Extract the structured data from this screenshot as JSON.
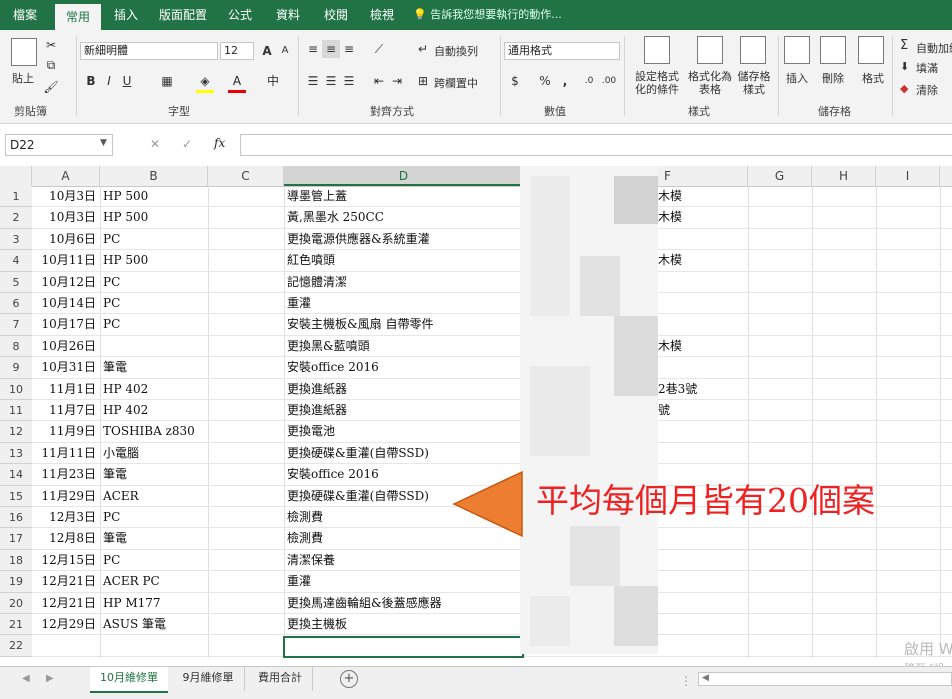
{
  "menu": {
    "items": [
      "檔案",
      "常用",
      "插入",
      "版面配置",
      "公式",
      "資料",
      "校閱",
      "檢視"
    ],
    "active": "常用",
    "tell_me": "告訴我您想要執行的動作..."
  },
  "ribbon": {
    "clipboard": {
      "paste_label": "貼上",
      "group": "剪貼簿"
    },
    "font": {
      "name": "新細明體",
      "size": "12",
      "bold": "B",
      "italic": "I",
      "underline": "U",
      "grow": "A",
      "shrink": "A",
      "group": "字型"
    },
    "alignment": {
      "wrap": "自動換列",
      "merge": "跨欄置中",
      "group": "對齊方式"
    },
    "number": {
      "format": "通用格式",
      "currency": "$",
      "percent": "%",
      "comma": ",",
      "group": "數值"
    },
    "styles": {
      "conditional": "設定格式化的條件",
      "table": "格式化為表格",
      "cell": "儲存格樣式",
      "group": "樣式"
    },
    "cells": {
      "insert": "插入",
      "delete": "刪除",
      "format": "格式",
      "group": "儲存格"
    },
    "editing": {
      "autosum": "自動加總",
      "fill": "填滿",
      "clear": "清除"
    }
  },
  "namebox": "D22",
  "fx_label": "fx",
  "columns": [
    "A",
    "B",
    "C",
    "D",
    "E",
    "F",
    "G",
    "H",
    "I"
  ],
  "selected_column": "D",
  "rows": [
    {
      "n": "1",
      "a": "10月3日",
      "b": "HP 500",
      "d": "導墨管上蓋",
      "f": "木模"
    },
    {
      "n": "2",
      "a": "10月3日",
      "b": "HP 500",
      "d": "黃,黑墨水 250CC",
      "f": "木模"
    },
    {
      "n": "3",
      "a": "10月6日",
      "b": "PC",
      "d": "更換電源供應器&系統重灌",
      "f": ""
    },
    {
      "n": "4",
      "a": "10月11日",
      "b": "HP 500",
      "d": "紅色噴頭",
      "f": "木模"
    },
    {
      "n": "5",
      "a": "10月12日",
      "b": "PC",
      "d": "記憶體清潔",
      "f": ""
    },
    {
      "n": "6",
      "a": "10月14日",
      "b": "PC",
      "d": "重灌",
      "f": ""
    },
    {
      "n": "7",
      "a": "10月17日",
      "b": "PC",
      "d": "安裝主機板&風扇 自帶零件",
      "f": ""
    },
    {
      "n": "8",
      "a": "10月26日",
      "b": "",
      "d": "更換黑&藍噴頭",
      "f": "木模"
    },
    {
      "n": "9",
      "a": "10月31日",
      "b": "筆電",
      "d": "安裝office 2016",
      "f": ""
    },
    {
      "n": "10",
      "a": "11月1日",
      "b": "HP 402",
      "d": "更換進紙器",
      "f": "2巷3號"
    },
    {
      "n": "11",
      "a": "11月7日",
      "b": "HP 402",
      "d": "更換進紙器",
      "f": "號"
    },
    {
      "n": "12",
      "a": "11月9日",
      "b": "TOSHIBA z830",
      "d": "更換電池",
      "f": ""
    },
    {
      "n": "13",
      "a": "11月11日",
      "b": "小電腦",
      "d": "更換硬碟&重灌(自帶SSD)",
      "f": ""
    },
    {
      "n": "14",
      "a": "11月23日",
      "b": "筆電",
      "d": "安裝office 2016",
      "f": ""
    },
    {
      "n": "15",
      "a": "11月29日",
      "b": "ACER",
      "d": "更換硬碟&重灌(自帶SSD)",
      "f": ""
    },
    {
      "n": "16",
      "a": "12月3日",
      "b": "PC",
      "d": "檢測費",
      "f": ""
    },
    {
      "n": "17",
      "a": "12月8日",
      "b": "筆電",
      "d": "檢測費",
      "f": ""
    },
    {
      "n": "18",
      "a": "12月15日",
      "b": "PC",
      "d": "清潔保養",
      "f": ""
    },
    {
      "n": "19",
      "a": "12月21日",
      "b": "ACER PC",
      "d": "重灌",
      "f": ""
    },
    {
      "n": "20",
      "a": "12月21日",
      "b": "HP M177",
      "d": "更換馬達齒輪組&後蓋感應器",
      "f": ""
    },
    {
      "n": "21",
      "a": "12月29日",
      "b": "ASUS 筆電",
      "d": "更換主機板",
      "f": ""
    },
    {
      "n": "22",
      "a": "",
      "b": "",
      "d": "",
      "f": ""
    }
  ],
  "annotation": "平均每個月皆有20個案",
  "sheets": [
    "10月維修單",
    "9月維修單",
    "費用合計"
  ],
  "active_sheet": "10月維修單",
  "watermark": [
    "啟用 W",
    "移至 [設"
  ],
  "colors": {
    "excel_green": "#217346",
    "annotation_red": "#e22222",
    "arrow_orange": "#ed7d31"
  }
}
